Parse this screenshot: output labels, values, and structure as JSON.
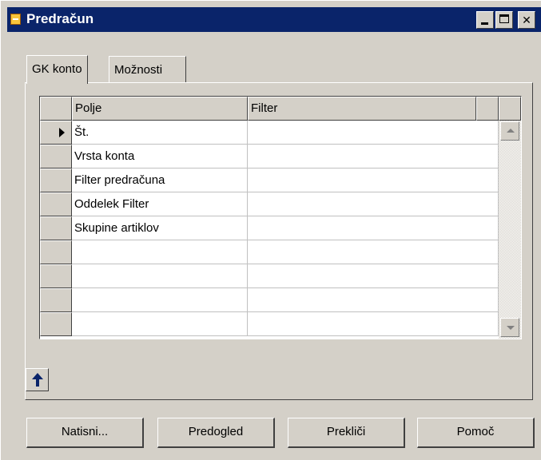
{
  "window": {
    "title": "Predračun",
    "controls": [
      "minimize",
      "maximize",
      "close"
    ]
  },
  "tabs": [
    {
      "label": "GK konto",
      "active": true
    },
    {
      "label": "Možnosti",
      "active": false
    }
  ],
  "grid": {
    "columns": [
      "Polje",
      "Filter"
    ],
    "rows": [
      {
        "field": "Št.",
        "filter": "",
        "current": true
      },
      {
        "field": "Vrsta konta",
        "filter": ""
      },
      {
        "field": "Filter predračuna",
        "filter": ""
      },
      {
        "field": "Oddelek Filter",
        "filter": ""
      },
      {
        "field": "Skupine artiklov",
        "filter": ""
      },
      {
        "field": "",
        "filter": ""
      },
      {
        "field": "",
        "filter": ""
      },
      {
        "field": "",
        "filter": ""
      },
      {
        "field": "",
        "filter": ""
      }
    ]
  },
  "buttons": {
    "print": "Natisni...",
    "preview": "Predogled",
    "cancel": "Prekliči",
    "help": "Pomoč"
  },
  "icons": {
    "app": "window-app-icon",
    "up": "up-arrow-icon"
  }
}
